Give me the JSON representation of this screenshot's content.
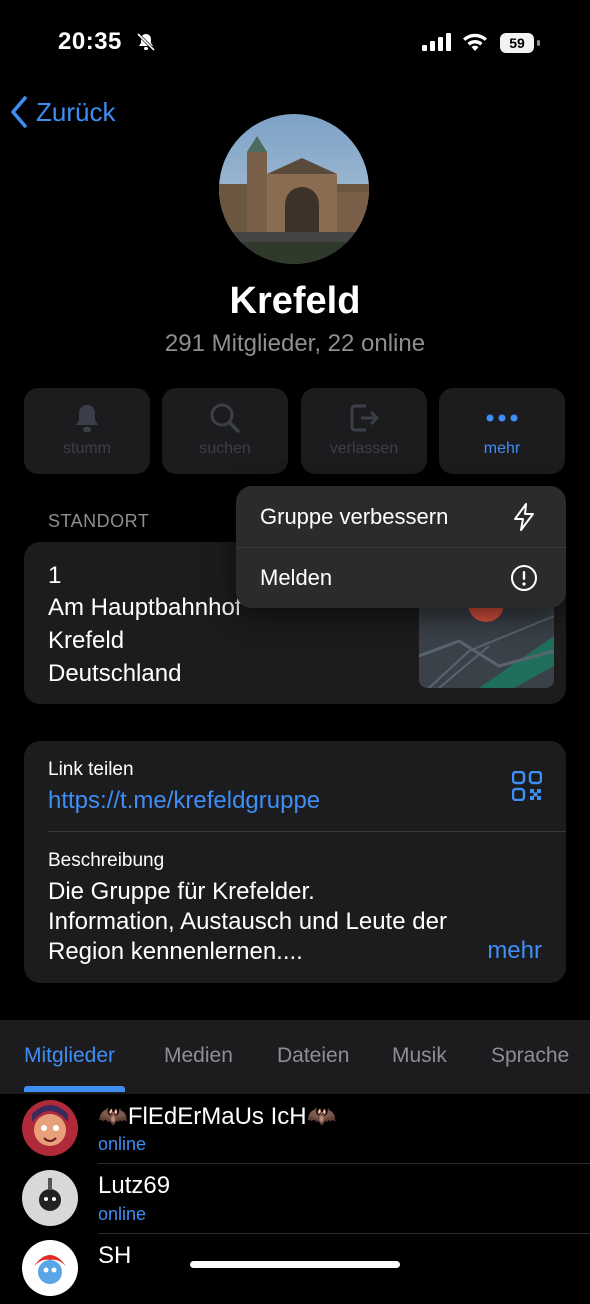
{
  "status_bar": {
    "time": "20:35",
    "battery": "59"
  },
  "nav": {
    "back_label": "Zurück"
  },
  "group": {
    "name": "Krefeld",
    "subtitle": "291 Mitglieder, 22 online"
  },
  "actions": [
    {
      "label": "stumm",
      "icon": "bell-icon"
    },
    {
      "label": "suchen",
      "icon": "search-icon"
    },
    {
      "label": "verlassen",
      "icon": "leave-icon"
    },
    {
      "label": "mehr",
      "icon": "more-dots-icon"
    }
  ],
  "location": {
    "header": "STANDORT",
    "lines": [
      "1",
      "Am Hauptbahnhof",
      "Krefeld",
      "Deutschland"
    ]
  },
  "menu": {
    "items": [
      {
        "label": "Gruppe verbessern",
        "icon": "lightning-icon"
      },
      {
        "label": "Melden",
        "icon": "exclamation-circle-icon"
      }
    ]
  },
  "info": {
    "link_label": "Link teilen",
    "link_url": "https://t.me/krefeldgruppe",
    "description_label": "Beschreibung",
    "description_lines": [
      "Die Gruppe für Krefelder.",
      "Information, Austausch und Leute der",
      "Region kennenlernen...."
    ],
    "more": "mehr"
  },
  "tabs": [
    "Mitglieder",
    "Medien",
    "Dateien",
    "Musik",
    "Sprache"
  ],
  "members": [
    {
      "name": "🦇FlEdErMaUs IcH🦇",
      "status": "online"
    },
    {
      "name": "Lutz69",
      "status": "online"
    },
    {
      "name": "SH",
      "status": ""
    }
  ],
  "colors": {
    "accent": "#3e8ef5",
    "card": "#1c1c1e",
    "background": "#000000"
  }
}
